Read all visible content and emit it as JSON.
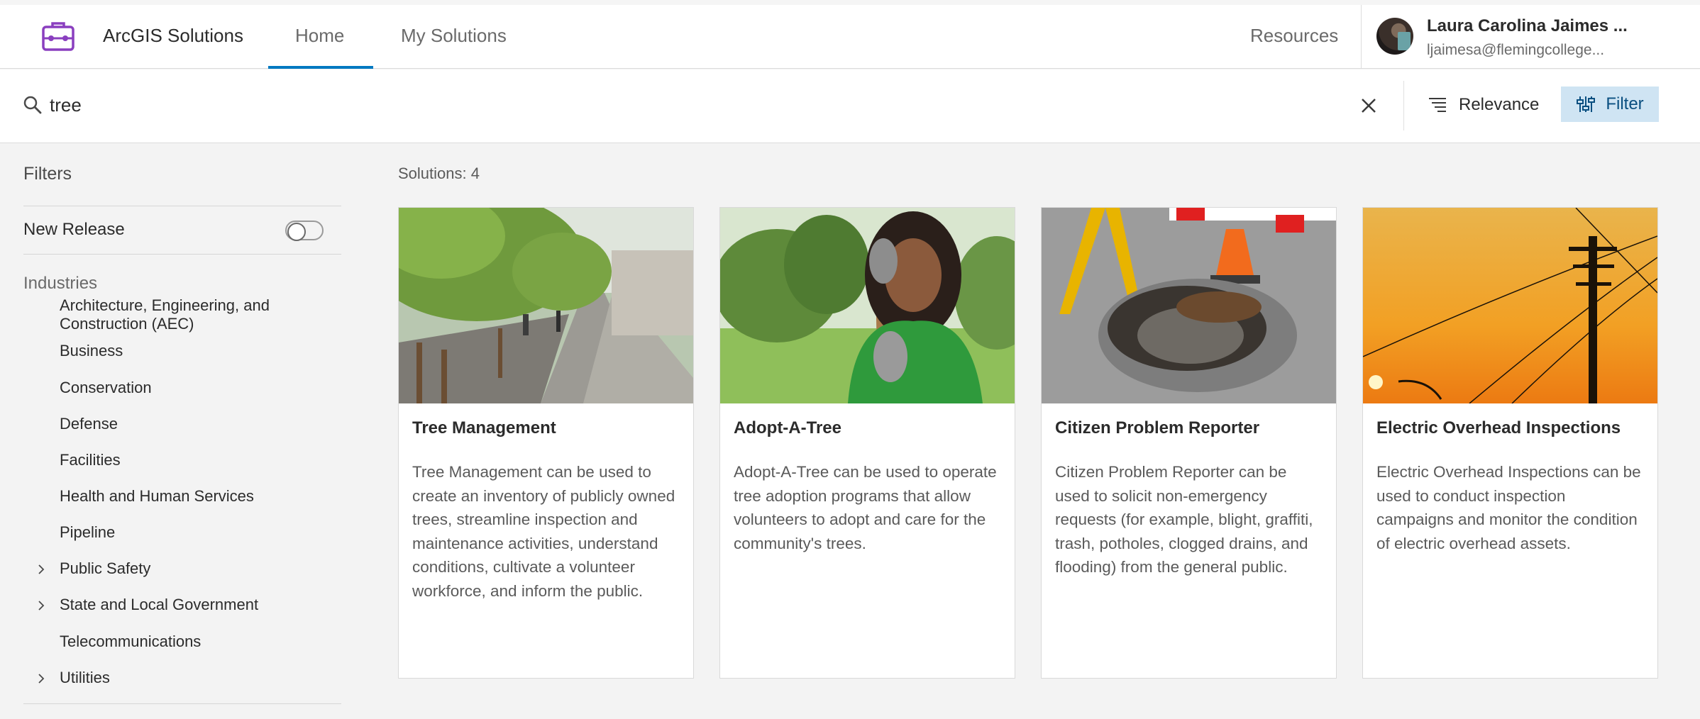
{
  "header": {
    "app_title": "ArcGIS Solutions",
    "tabs": [
      {
        "label": "Home",
        "active": true
      },
      {
        "label": "My Solutions",
        "active": false
      }
    ],
    "resources_label": "Resources",
    "user": {
      "name": "Laura Carolina Jaimes ...",
      "email": "ljaimesa@flemingcollege..."
    },
    "accent_color": "#0079c1",
    "logo_color": "#8a3fbf"
  },
  "search": {
    "value": "tree",
    "icons": [
      "search-icon",
      "close-icon"
    ]
  },
  "toolbar": {
    "sort_label": "Relevance",
    "filter_label": "Filter",
    "filter_bg": "#cfe4f3"
  },
  "sidebar": {
    "title": "Filters",
    "new_release_label": "New Release",
    "new_release_on": false,
    "industries_title": "Industries",
    "industries": [
      {
        "label": "Architecture, Engineering, and Construction (AEC)",
        "expandable": false
      },
      {
        "label": "Business",
        "expandable": false
      },
      {
        "label": "Conservation",
        "expandable": false
      },
      {
        "label": "Defense",
        "expandable": false
      },
      {
        "label": "Facilities",
        "expandable": false
      },
      {
        "label": "Health and Human Services",
        "expandable": false
      },
      {
        "label": "Pipeline",
        "expandable": false
      },
      {
        "label": "Public Safety",
        "expandable": true
      },
      {
        "label": "State and Local Government",
        "expandable": true
      },
      {
        "label": "Telecommunications",
        "expandable": false
      },
      {
        "label": "Utilities",
        "expandable": true
      }
    ]
  },
  "results": {
    "count_label": "Solutions: 4",
    "cards": [
      {
        "title": "Tree Management",
        "description": "Tree Management can be used to create an inventory of publicly owned trees, streamline inspection and maintenance activities, understand conditions, cultivate a volunteer workforce, and inform the public.",
        "image": "tree-lined-sidewalk-image"
      },
      {
        "title": "Adopt-A-Tree",
        "description": "Adopt-A-Tree can be used to operate tree adoption programs that allow volunteers to adopt and care for the community's trees.",
        "image": "volunteer-with-shovel-image"
      },
      {
        "title": "Citizen Problem Reporter",
        "description": "Citizen Problem Reporter can be used to solicit non-emergency requests (for example, blight, graffiti, trash, potholes, clogged drains, and flooding) from the general public.",
        "image": "pothole-with-cones-image"
      },
      {
        "title": "Electric Overhead Inspections",
        "description": "Electric Overhead Inspections can be used to conduct inspection campaigns and monitor the condition of electric overhead assets.",
        "image": "power-pole-sunset-image"
      }
    ]
  }
}
